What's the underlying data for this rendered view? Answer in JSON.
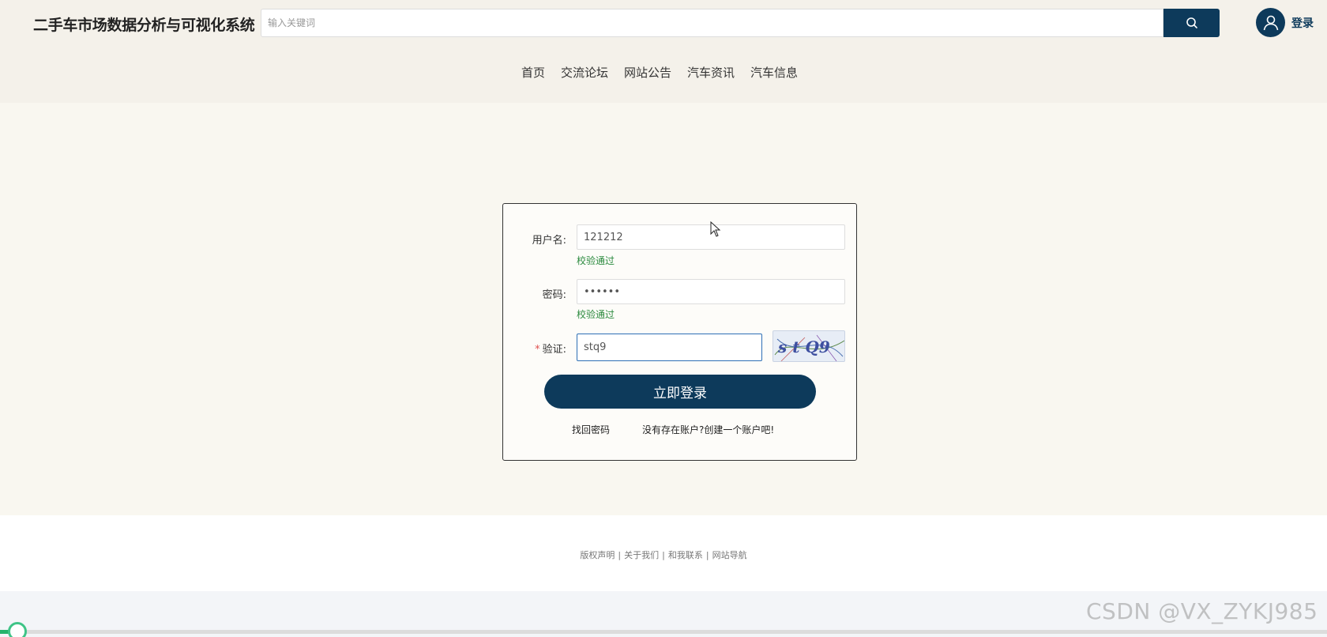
{
  "header": {
    "site_title": "二手车市场数据分析与可视化系统",
    "search_placeholder": "输入关键词",
    "search_icon": "search-icon",
    "avatar_icon": "user-icon",
    "login_label": "登录"
  },
  "nav": {
    "items": [
      {
        "label": "首页"
      },
      {
        "label": "交流论坛"
      },
      {
        "label": "网站公告"
      },
      {
        "label": "汽车资讯"
      },
      {
        "label": "汽车信息"
      }
    ]
  },
  "login_form": {
    "username_label": "用户名:",
    "username_value": "121212",
    "username_valid": "校验通过",
    "password_label": "密码:",
    "password_value": "••••••",
    "password_valid": "校验通过",
    "captcha_required_mark": "*",
    "captcha_label": "验证:",
    "captcha_value": "stq9",
    "captcha_image_text": "s t Q9",
    "submit_label": "立即登录",
    "forgot_password": "找回密码",
    "register_link": "没有存在账户?创建一个账户吧!"
  },
  "footer": {
    "links": [
      {
        "label": "版权声明"
      },
      {
        "label": "关于我们"
      },
      {
        "label": "和我联系"
      },
      {
        "label": "网站导航"
      }
    ],
    "separator": "|"
  },
  "watermark": "CSDN @VX_ZYKJ985",
  "colors": {
    "primary": "#0d3a5b",
    "valid_green": "#2b8a3e",
    "header_bg": "#f4f1ea",
    "main_bg": "#f9f7f0"
  }
}
